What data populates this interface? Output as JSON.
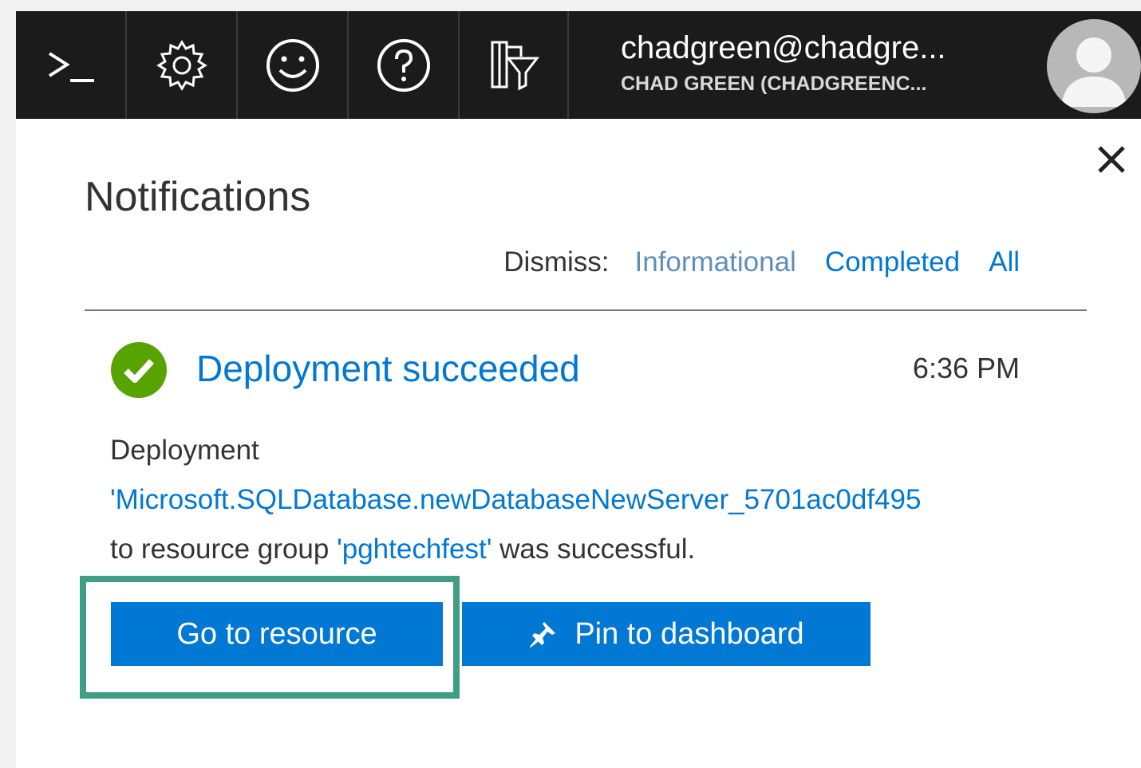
{
  "topbar": {
    "icons": [
      "cloud-shell-icon",
      "settings-gear-icon",
      "feedback-smiley-icon",
      "help-question-icon",
      "directory-filter-icon"
    ],
    "user": {
      "email": "chadgreen@chadgre...",
      "tenant": "CHAD GREEN (CHADGREENC..."
    }
  },
  "panel": {
    "title": "Notifications",
    "dismiss": {
      "label": "Dismiss:",
      "options": [
        "Informational",
        "Completed",
        "All"
      ]
    }
  },
  "notification": {
    "title": "Deployment succeeded",
    "time": "6:36 PM",
    "message_prefix": "Deployment",
    "deployment_name": "'Microsoft.SQLDatabase.newDatabaseNewServer_5701ac0df495",
    "message_middle": "to resource group",
    "resource_group": "'pghtechfest'",
    "message_suffix": "was successful.",
    "actions": {
      "go_to_resource": "Go to resource",
      "pin_to_dashboard": "Pin to dashboard"
    }
  },
  "colors": {
    "topbar": "#1b1b1b",
    "accent": "#0078d4",
    "success": "#57a300",
    "highlight": "#3f9e86"
  }
}
